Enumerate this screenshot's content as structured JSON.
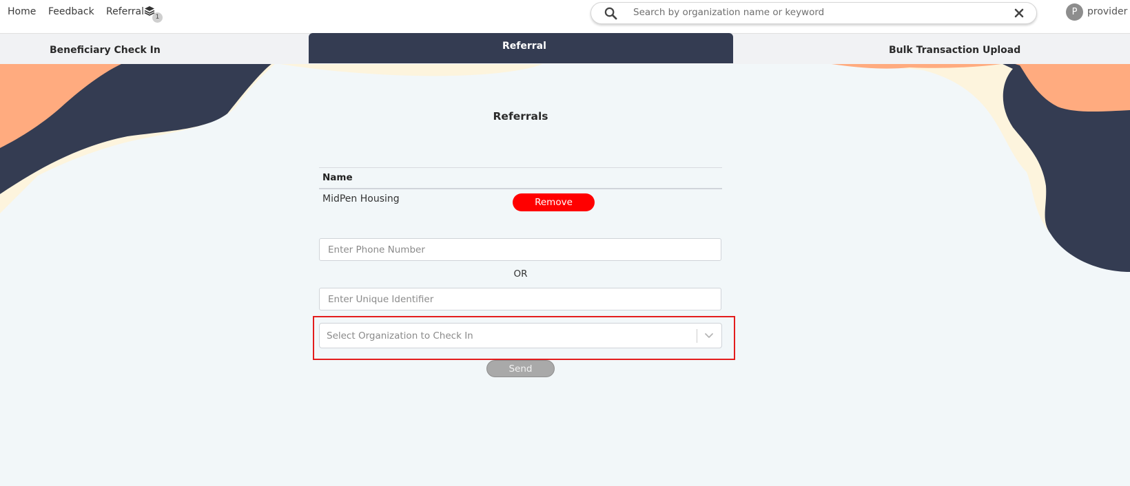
{
  "nav": {
    "home": "Home",
    "feedback": "Feedback",
    "referral": "Referral",
    "referral_count": "1"
  },
  "search": {
    "placeholder": "Search by organization name or keyword"
  },
  "user": {
    "avatar_initial": "P",
    "name": "provider"
  },
  "tabs": [
    {
      "label": "Beneficiary Check In",
      "active": false
    },
    {
      "label": "Referral",
      "active": true
    },
    {
      "label": "Bulk Transaction Upload",
      "active": false
    }
  ],
  "main": {
    "title": "Referrals",
    "table": {
      "columns": [
        "Name"
      ],
      "rows": [
        {
          "name": "MidPen Housing",
          "action": "Remove"
        }
      ]
    },
    "phone_placeholder": "Enter Phone Number",
    "or_label": "OR",
    "identifier_placeholder": "Enter Unique Identifier",
    "select_placeholder": "Select Organization to Check In",
    "send_label": "Send"
  },
  "colors": {
    "navy": "#343c52",
    "orange": "#ffab7f",
    "cream": "#fdf4dd",
    "danger": "#ff0000",
    "highlight": "#e31c1c"
  }
}
